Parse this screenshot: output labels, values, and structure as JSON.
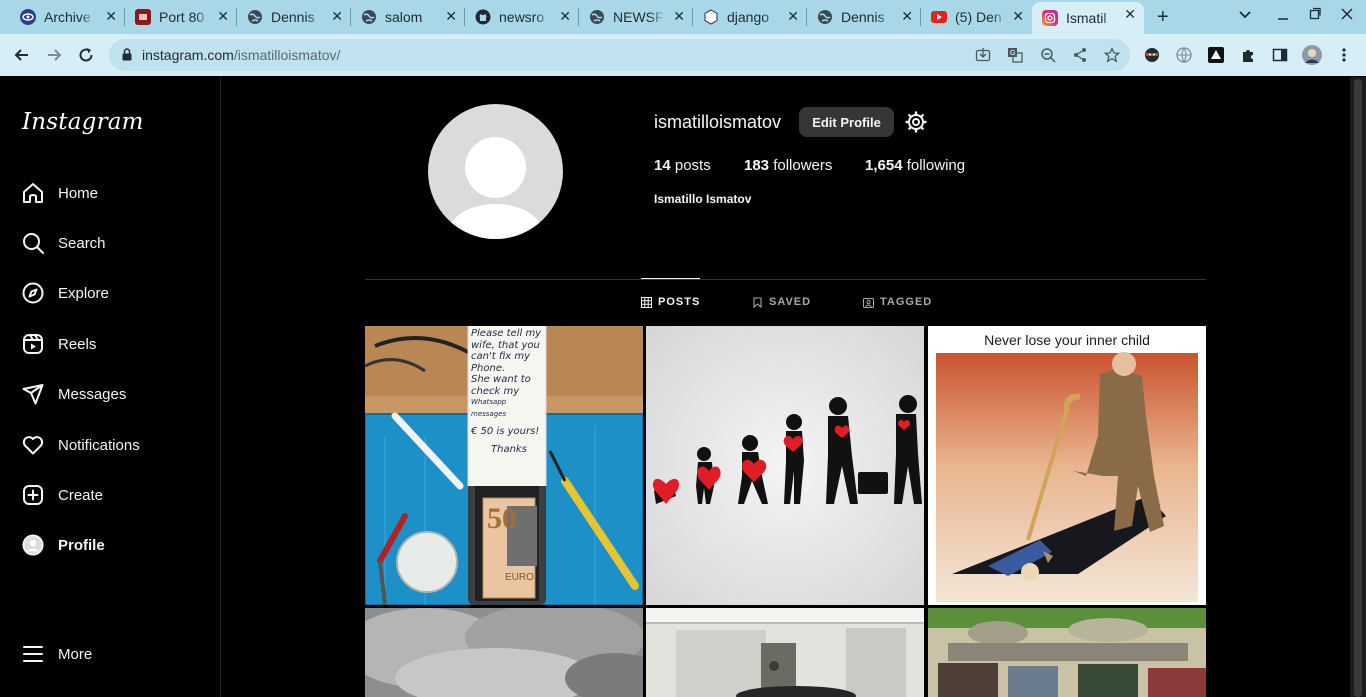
{
  "browser": {
    "tabs": [
      {
        "title": "Archive",
        "icon": "archive-favicon"
      },
      {
        "title": "Port 80",
        "icon": "port-favicon"
      },
      {
        "title": "Dennis",
        "icon": "globe-icon"
      },
      {
        "title": "salom",
        "icon": "globe-icon"
      },
      {
        "title": "newsro",
        "icon": "github-icon"
      },
      {
        "title": "NEWSF",
        "icon": "globe-icon"
      },
      {
        "title": "django",
        "icon": "django-favicon"
      },
      {
        "title": "Dennis",
        "icon": "globe-icon"
      },
      {
        "title": "(5) Den",
        "icon": "youtube-icon"
      },
      {
        "title": "Ismatil",
        "icon": "instagram-icon"
      }
    ],
    "url_host": "instagram.com",
    "url_path": "/ismatilloismatov/"
  },
  "sidebar": {
    "logo": "Instagram",
    "items": [
      {
        "label": "Home",
        "icon": "home-icon"
      },
      {
        "label": "Search",
        "icon": "search-icon"
      },
      {
        "label": "Explore",
        "icon": "compass-icon"
      },
      {
        "label": "Reels",
        "icon": "reels-icon"
      },
      {
        "label": "Messages",
        "icon": "messages-icon"
      },
      {
        "label": "Notifications",
        "icon": "heart-icon"
      },
      {
        "label": "Create",
        "icon": "plus-square-icon"
      },
      {
        "label": "Profile",
        "icon": "avatar-icon"
      }
    ],
    "more": "More"
  },
  "profile": {
    "username": "ismatilloismatov",
    "edit_label": "Edit Profile",
    "posts_count": "14",
    "posts_label": "posts",
    "followers_count": "183",
    "followers_label": "followers",
    "following_count": "1,654",
    "following_label": "following",
    "full_name": "Ismatillo Ismatov"
  },
  "tabs": {
    "posts": "POSTS",
    "saved": "SAVED",
    "tagged": "TAGGED"
  },
  "posts": {
    "post1_note": [
      "Please tell my",
      "wife, that you",
      "can't fix my",
      "Phone.",
      "She want to",
      "check my",
      "Whatsapp messages",
      "€ 50 is yours!",
      "Thanks"
    ],
    "post1_bill": "50",
    "post1_euro": "EURO",
    "post3_caption": "Never lose your inner child"
  },
  "colors": {
    "accent_active": "#f5f5f5",
    "inactive_tab": "#a8a8a8",
    "chrome_bg": "#a8d8e8"
  }
}
